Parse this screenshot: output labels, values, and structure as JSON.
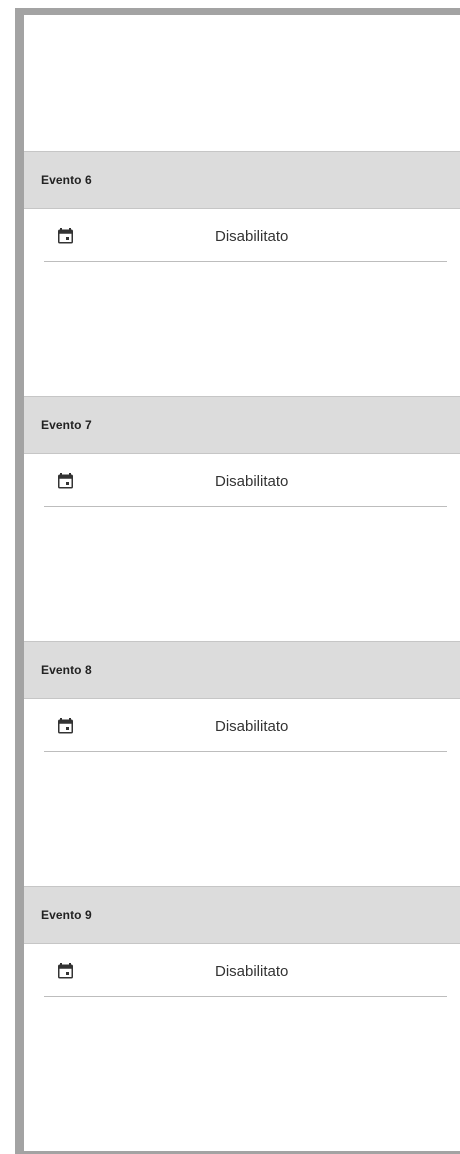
{
  "events": [
    {
      "title": "Evento 6",
      "status": "Disabilitato",
      "icon": "calendar-icon"
    },
    {
      "title": "Evento 7",
      "status": "Disabilitato",
      "icon": "calendar-icon"
    },
    {
      "title": "Evento 8",
      "status": "Disabilitato",
      "icon": "calendar-icon"
    },
    {
      "title": "Evento 9",
      "status": "Disabilitato",
      "icon": "calendar-icon"
    }
  ],
  "colors": {
    "frame_border": "#a3a3a3",
    "header_background": "#dcdcdc",
    "text": "#333333"
  }
}
